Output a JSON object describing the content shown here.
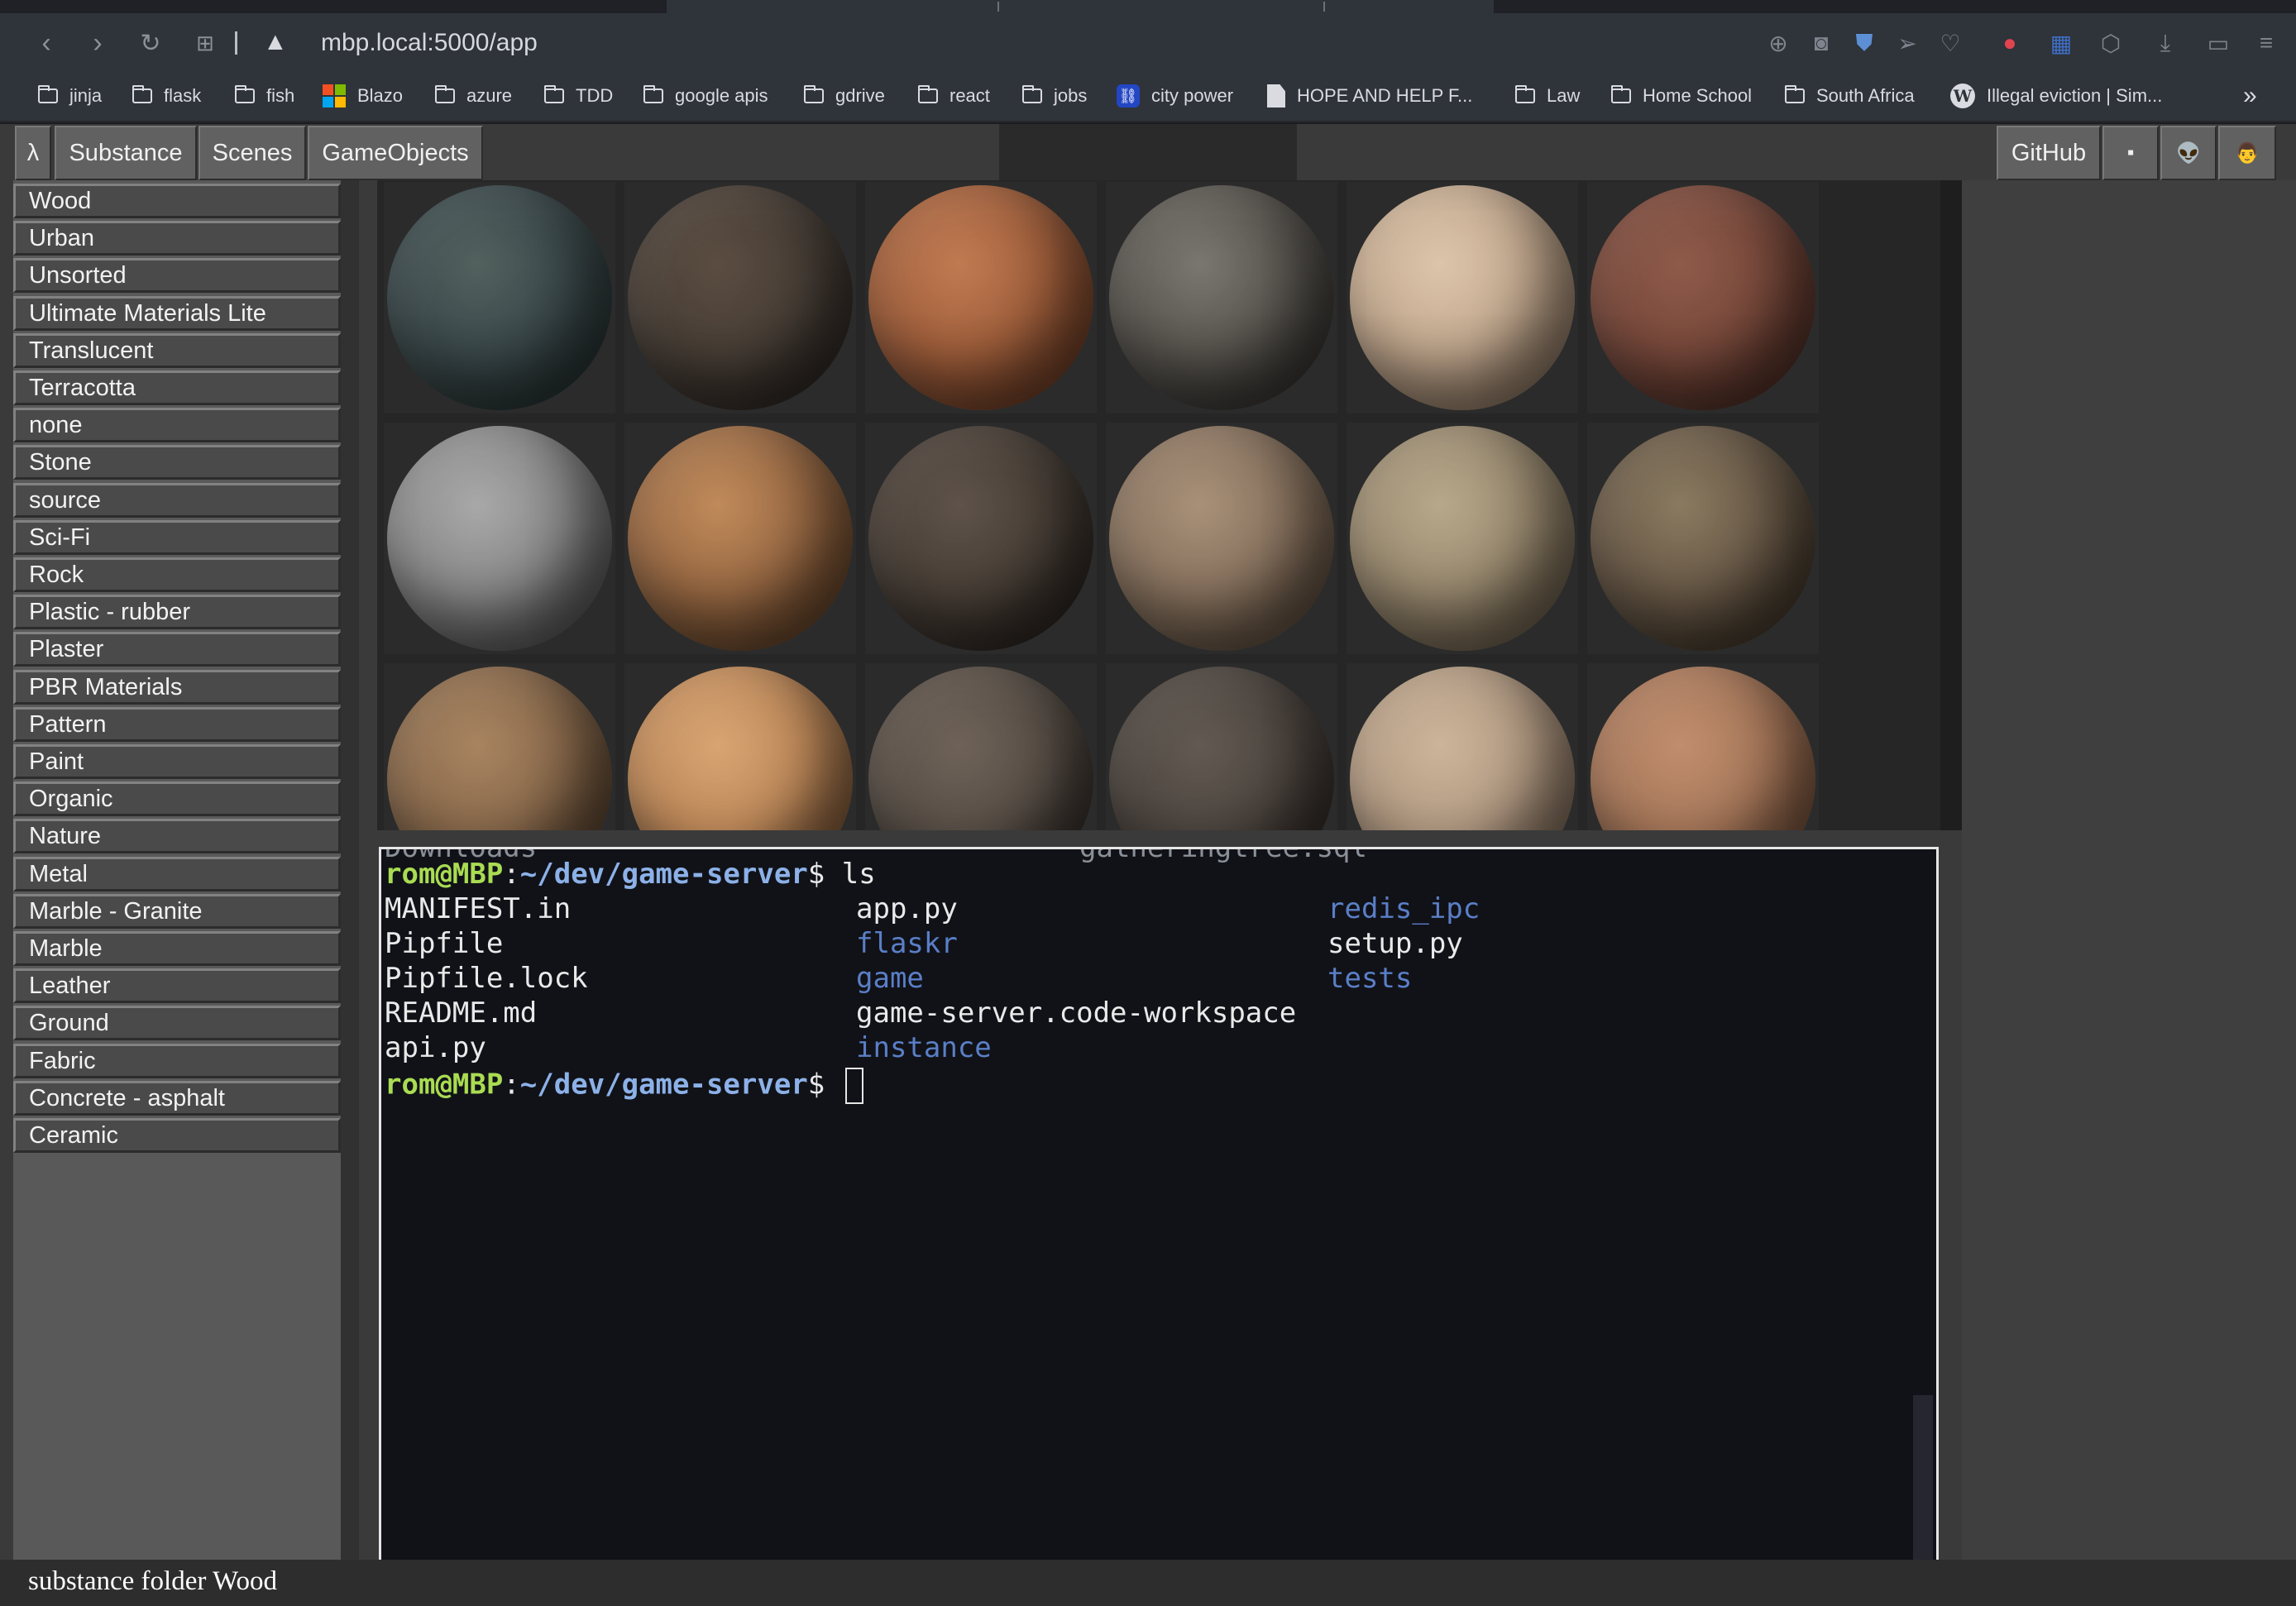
{
  "browser": {
    "url": "mbp.local:5000/app",
    "bookmarks": [
      {
        "label": "jinja",
        "icon": "folder-icon"
      },
      {
        "label": "flask",
        "icon": "folder-icon"
      },
      {
        "label": "fish",
        "icon": "folder-icon"
      },
      {
        "label": "Blazo",
        "icon": "microsoft-icon"
      },
      {
        "label": "azure",
        "icon": "folder-icon"
      },
      {
        "label": "TDD",
        "icon": "folder-icon"
      },
      {
        "label": "google apis",
        "icon": "folder-icon"
      },
      {
        "label": "gdrive",
        "icon": "folder-icon"
      },
      {
        "label": "react",
        "icon": "folder-icon"
      },
      {
        "label": "jobs",
        "icon": "folder-icon"
      },
      {
        "label": "city power",
        "icon": "link-icon"
      },
      {
        "label": "HOPE AND HELP F...",
        "icon": "document-icon"
      },
      {
        "label": "Law",
        "icon": "folder-icon"
      },
      {
        "label": "Home School",
        "icon": "folder-icon"
      },
      {
        "label": "South Africa",
        "icon": "folder-icon"
      },
      {
        "label": "Illegal eviction | Sim...",
        "icon": "wordpress-icon"
      }
    ],
    "overflow": "»"
  },
  "menu": {
    "lambda": "λ",
    "substance": "Substance",
    "scenes": "Scenes",
    "gameobjects": "GameObjects",
    "github": "GitHub",
    "icon1": "▪",
    "icon2": "👽",
    "icon3": "👨"
  },
  "folders": [
    "Wood",
    "Urban",
    "Unsorted",
    "Ultimate Materials Lite",
    "Translucent",
    "Terracotta",
    "none",
    "Stone",
    "source",
    "Sci-Fi",
    "Rock",
    "Plastic - rubber",
    "Plaster",
    "PBR Materials",
    "Pattern",
    "Paint",
    "Organic",
    "Nature",
    "Metal",
    "Marble - Granite",
    "Marble",
    "Leather",
    "Ground",
    "Fabric",
    "Concrete - asphalt",
    "Ceramic"
  ],
  "terminal": {
    "ghost_left": "Downloads",
    "ghost_mid": "gatheringtree.sql",
    "prompt_user": "rom@MBP",
    "prompt_sep": ":",
    "prompt_path": "~/dev/game-server",
    "prompt_end": "$ ",
    "command": "ls",
    "col1": [
      "MANIFEST.in",
      "Pipfile",
      "Pipfile.lock",
      "README.md",
      "api.py"
    ],
    "col2": [
      "app.py",
      "flaskr",
      "game",
      "game-server.code-workspace",
      "instance"
    ],
    "col3": [
      "redis_ipc",
      "setup.py",
      "tests"
    ]
  },
  "status": "substance folder Wood",
  "colors": {
    "prompt_user": "#a9dc52",
    "prompt_path": "#8cb1e8",
    "directory": "#5a7fc7"
  }
}
